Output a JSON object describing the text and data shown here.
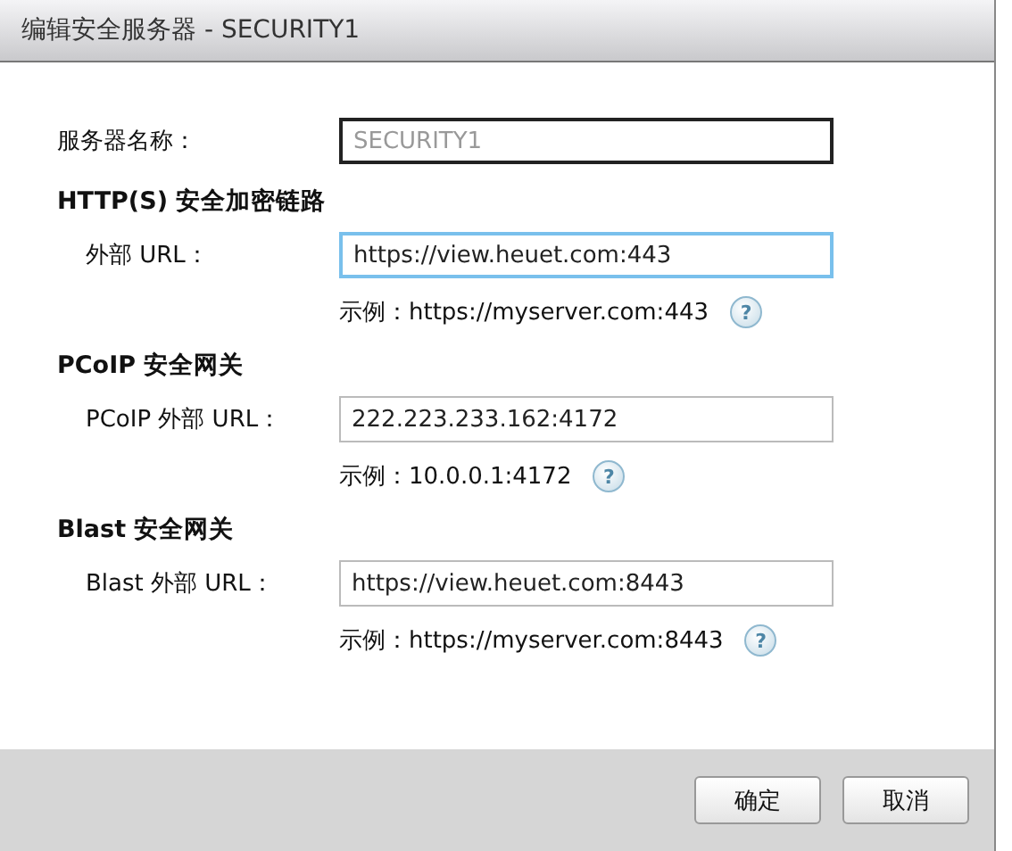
{
  "window": {
    "title": "编辑安全服务器 - SECURITY1"
  },
  "server_name": {
    "label": "服务器名称：",
    "value": "SECURITY1",
    "disabled": true
  },
  "sections": [
    {
      "heading": "HTTP(S) 安全加密链路",
      "label": "外部 URL：",
      "value": "https://view.heuet.com:443",
      "focused": true,
      "example": "示例：https://myserver.com:443",
      "help": "?"
    },
    {
      "heading": "PCoIP 安全网关",
      "label": "PCoIP 外部 URL：",
      "value": "222.223.233.162:4172",
      "focused": false,
      "example": "示例：10.0.0.1:4172",
      "help": "?"
    },
    {
      "heading": "Blast 安全网关",
      "label": "Blast 外部 URL：",
      "value": "https://view.heuet.com:8443",
      "focused": false,
      "example": "示例：https://myserver.com:8443",
      "help": "?"
    }
  ],
  "buttons": [
    {
      "label": "确定"
    },
    {
      "label": "取消"
    }
  ]
}
